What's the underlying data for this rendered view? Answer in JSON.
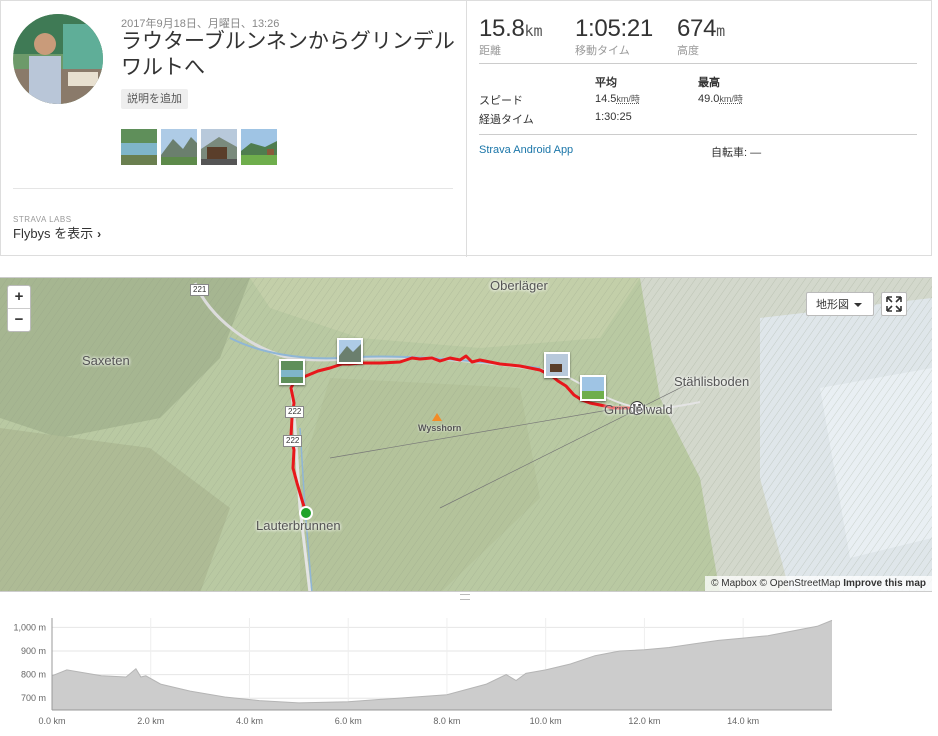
{
  "activity": {
    "date": "2017年9月18日、月曜日、13:26",
    "title": "ラウターブルンネンからグリンデルワルトへ",
    "add_description": "説明を追加",
    "labs": "STRAVA LABS",
    "flybys": "Flybys を表示"
  },
  "stats": {
    "distance": {
      "value": "15.8",
      "unit": "km",
      "label": "距離"
    },
    "moving_time": {
      "value": "1:05:21",
      "label": "移動タイム"
    },
    "elevation": {
      "value": "674",
      "unit": "m",
      "label": "高度"
    },
    "col_avg": "平均",
    "col_max": "最高",
    "speed_label": "スピード",
    "speed_avg": "14.5",
    "speed_max": "49.0",
    "speed_unit": "km/時",
    "elapsed_label": "経過タイム",
    "elapsed_value": "1:30:25",
    "device": "Strava Android App",
    "bike": "自転車: —"
  },
  "map": {
    "zoom_in": "+",
    "zoom_out": "−",
    "map_type": "地形図",
    "places": {
      "oberlager": "Oberläger",
      "saxeten": "Saxeten",
      "stahlisboden": "Stählisboden",
      "grindelwald": "Grindelwald",
      "lauterbrunnen": "Lauterbrunnen",
      "wysshorn": "Wysshorn"
    },
    "roads": [
      "221",
      "222",
      "222"
    ],
    "attribution_mapbox": "© Mapbox",
    "attribution_osm": "© OpenStreetMap",
    "attribution_improve": "Improve this map",
    "colors": {
      "route": "#e8171b",
      "start": "#1fa32a"
    }
  },
  "elevation_chart": {
    "y_ticks": [
      "1,000 m",
      "900 m",
      "800 m",
      "700 m"
    ],
    "x_ticks": [
      "0.0 km",
      "2.0 km",
      "4.0 km",
      "6.0 km",
      "8.0 km",
      "10.0 km",
      "12.0 km",
      "14.0 km"
    ]
  },
  "chart_data": {
    "type": "area",
    "xlabel": "",
    "ylabel": "",
    "x_unit": "km",
    "y_unit": "m",
    "xlim": [
      0,
      15.8
    ],
    "ylim": [
      650,
      1040
    ],
    "x": [
      0,
      0.3,
      1.0,
      1.5,
      1.7,
      1.8,
      1.9,
      2.2,
      2.8,
      3.5,
      4.2,
      5.0,
      6.0,
      7.0,
      8.0,
      8.8,
      9.2,
      9.4,
      9.6,
      10.0,
      10.5,
      11.0,
      11.5,
      12.0,
      12.5,
      13.0,
      13.5,
      14.0,
      14.5,
      15.0,
      15.5,
      15.8
    ],
    "y": [
      795,
      820,
      795,
      790,
      825,
      790,
      795,
      760,
      730,
      705,
      690,
      680,
      685,
      700,
      715,
      760,
      800,
      775,
      805,
      820,
      845,
      880,
      900,
      905,
      915,
      930,
      945,
      955,
      965,
      985,
      1005,
      1030
    ]
  }
}
